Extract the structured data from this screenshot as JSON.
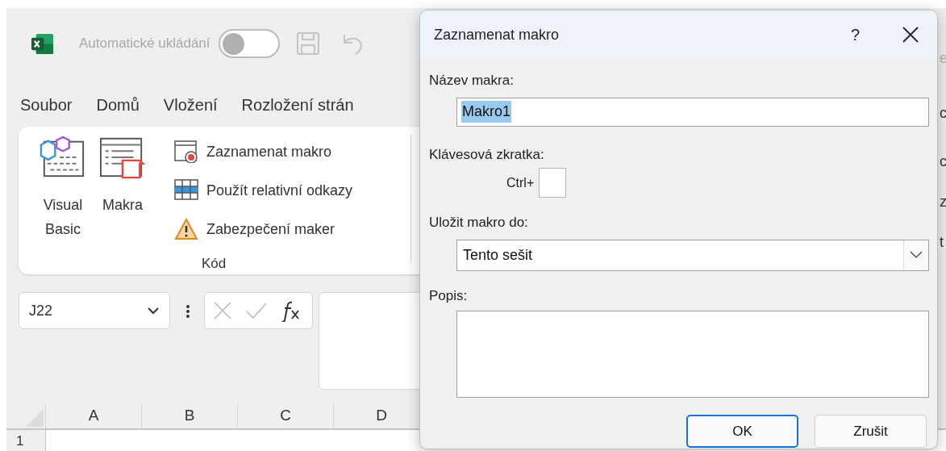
{
  "app": {
    "autosave_label": "Automatické ukládání",
    "autosave_on": false
  },
  "menu_tabs": [
    "Soubor",
    "Domů",
    "Vložení",
    "Rozložení strán"
  ],
  "ribbon": {
    "large_buttons": [
      {
        "kind": "vba",
        "label_lines": [
          "Visual",
          "Basic"
        ]
      },
      {
        "kind": "macros",
        "label_lines": [
          "Makra"
        ]
      }
    ],
    "small_buttons": [
      {
        "kind": "record",
        "label": "Zaznamenat makro"
      },
      {
        "kind": "relative",
        "label": "Použít relativní odkazy"
      },
      {
        "kind": "security",
        "label": "Zabezpečení maker"
      }
    ],
    "group_label": "Kód"
  },
  "name_box": "J22",
  "columns": [
    "A",
    "B",
    "C",
    "D"
  ],
  "rows": [
    "1"
  ],
  "edge_fragments": [
    {
      "text": "e",
      "kind": "grey"
    },
    {
      "text": "c",
      "kind": "dark"
    },
    {
      "text": "c",
      "kind": "dark"
    },
    {
      "text": "z",
      "kind": "dark"
    },
    {
      "text": "t",
      "kind": "dark"
    }
  ],
  "dialog": {
    "title": "Zaznamenat makro",
    "help": "?",
    "name_label": "Název makra:",
    "name_value": "Makro1",
    "name_selected": true,
    "shortcut_label": "Klávesová zkratka:",
    "ctrl_label": "Ctrl+",
    "store_label": "Uložit makro do:",
    "store_value": "Tento sešit",
    "description_label": "Popis:",
    "buttons": [
      {
        "label": "OK",
        "default": true
      },
      {
        "label": "Zrušit",
        "default": false
      }
    ]
  }
}
